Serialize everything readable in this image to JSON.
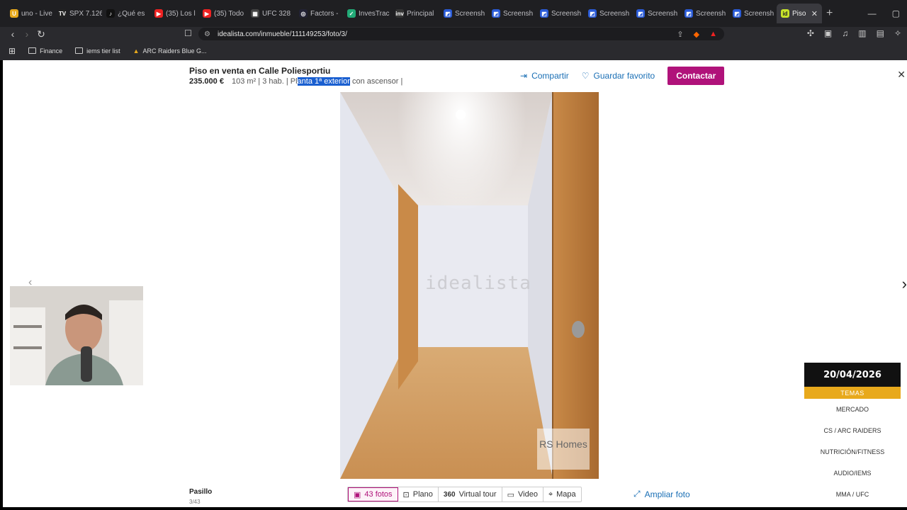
{
  "browser": {
    "tabs": [
      {
        "label": "uno - Live",
        "color": "#e8a91c",
        "glyph": "U"
      },
      {
        "label": "SPX 7.126",
        "color": "#222",
        "glyph": "TV"
      },
      {
        "label": "¿Qué es",
        "color": "#111",
        "glyph": "♪"
      },
      {
        "label": "(35) Los l",
        "color": "#e22",
        "glyph": "▶"
      },
      {
        "label": "(35) Todo",
        "color": "#e22",
        "glyph": "▶"
      },
      {
        "label": "UFC 328",
        "color": "#444",
        "glyph": "▦"
      },
      {
        "label": "Factors -",
        "color": "#223",
        "glyph": "◎"
      },
      {
        "label": "InvesTrac",
        "color": "#2a7",
        "glyph": "✓"
      },
      {
        "label": "Principal",
        "color": "#333",
        "glyph": "inv"
      },
      {
        "label": "Screensh",
        "color": "#2a5bd7",
        "glyph": "◩"
      },
      {
        "label": "Screensh",
        "color": "#2a5bd7",
        "glyph": "◩"
      },
      {
        "label": "Screensh",
        "color": "#2a5bd7",
        "glyph": "◩"
      },
      {
        "label": "Screensh",
        "color": "#2a5bd7",
        "glyph": "◩"
      },
      {
        "label": "Screensh",
        "color": "#2a5bd7",
        "glyph": "◩"
      },
      {
        "label": "Screensh",
        "color": "#2a5bd7",
        "glyph": "◩"
      },
      {
        "label": "Screensh",
        "color": "#2a5bd7",
        "glyph": "◩"
      }
    ],
    "active_tab": {
      "label": "Piso",
      "glyph": "id",
      "color": "#c7e32a"
    },
    "url": "idealista.com/inmueble/111149253/foto/3/",
    "bookmarks": [
      "Finance",
      "iems tier list",
      "ARC Raiders Blue G..."
    ]
  },
  "listing": {
    "title": "Piso en venta en Calle Poliesportiu",
    "price": "235.000 €",
    "info_before": "103 m²  |  3 hab.  |  Pl",
    "info_selected": "anta 1ª exterior",
    "info_after": " con ascensor  |",
    "share_label": "Compartir",
    "favorite_label": "Guardar favorito",
    "contact_label": "Contactar"
  },
  "photo": {
    "watermark": "idealista",
    "logo_text": "RS Homes"
  },
  "footer": {
    "caption": "Pasillo",
    "counter": "3/43",
    "tabs": [
      {
        "label": "43 fotos",
        "icon": "photos-icon"
      },
      {
        "label": "Plano",
        "icon": "floorplan-icon"
      },
      {
        "label": "Virtual tour",
        "icon": "360-icon"
      },
      {
        "label": "Video",
        "icon": "video-icon"
      },
      {
        "label": "Mapa",
        "icon": "map-pin-icon"
      }
    ],
    "badge_360": "360",
    "expand_label": "Ampliar foto"
  },
  "overlay": {
    "date": "20/04/2026",
    "header": "TEMAS",
    "items": [
      "MERCADO",
      "CS / ARC RAIDERS",
      "NUTRICIÓN/FITNESS",
      "AUDIO/IEMS",
      "MMA / UFC"
    ]
  },
  "colors": {
    "brand": "#b0127a",
    "link": "#1a6fb5",
    "accent": "#e8a91c"
  }
}
